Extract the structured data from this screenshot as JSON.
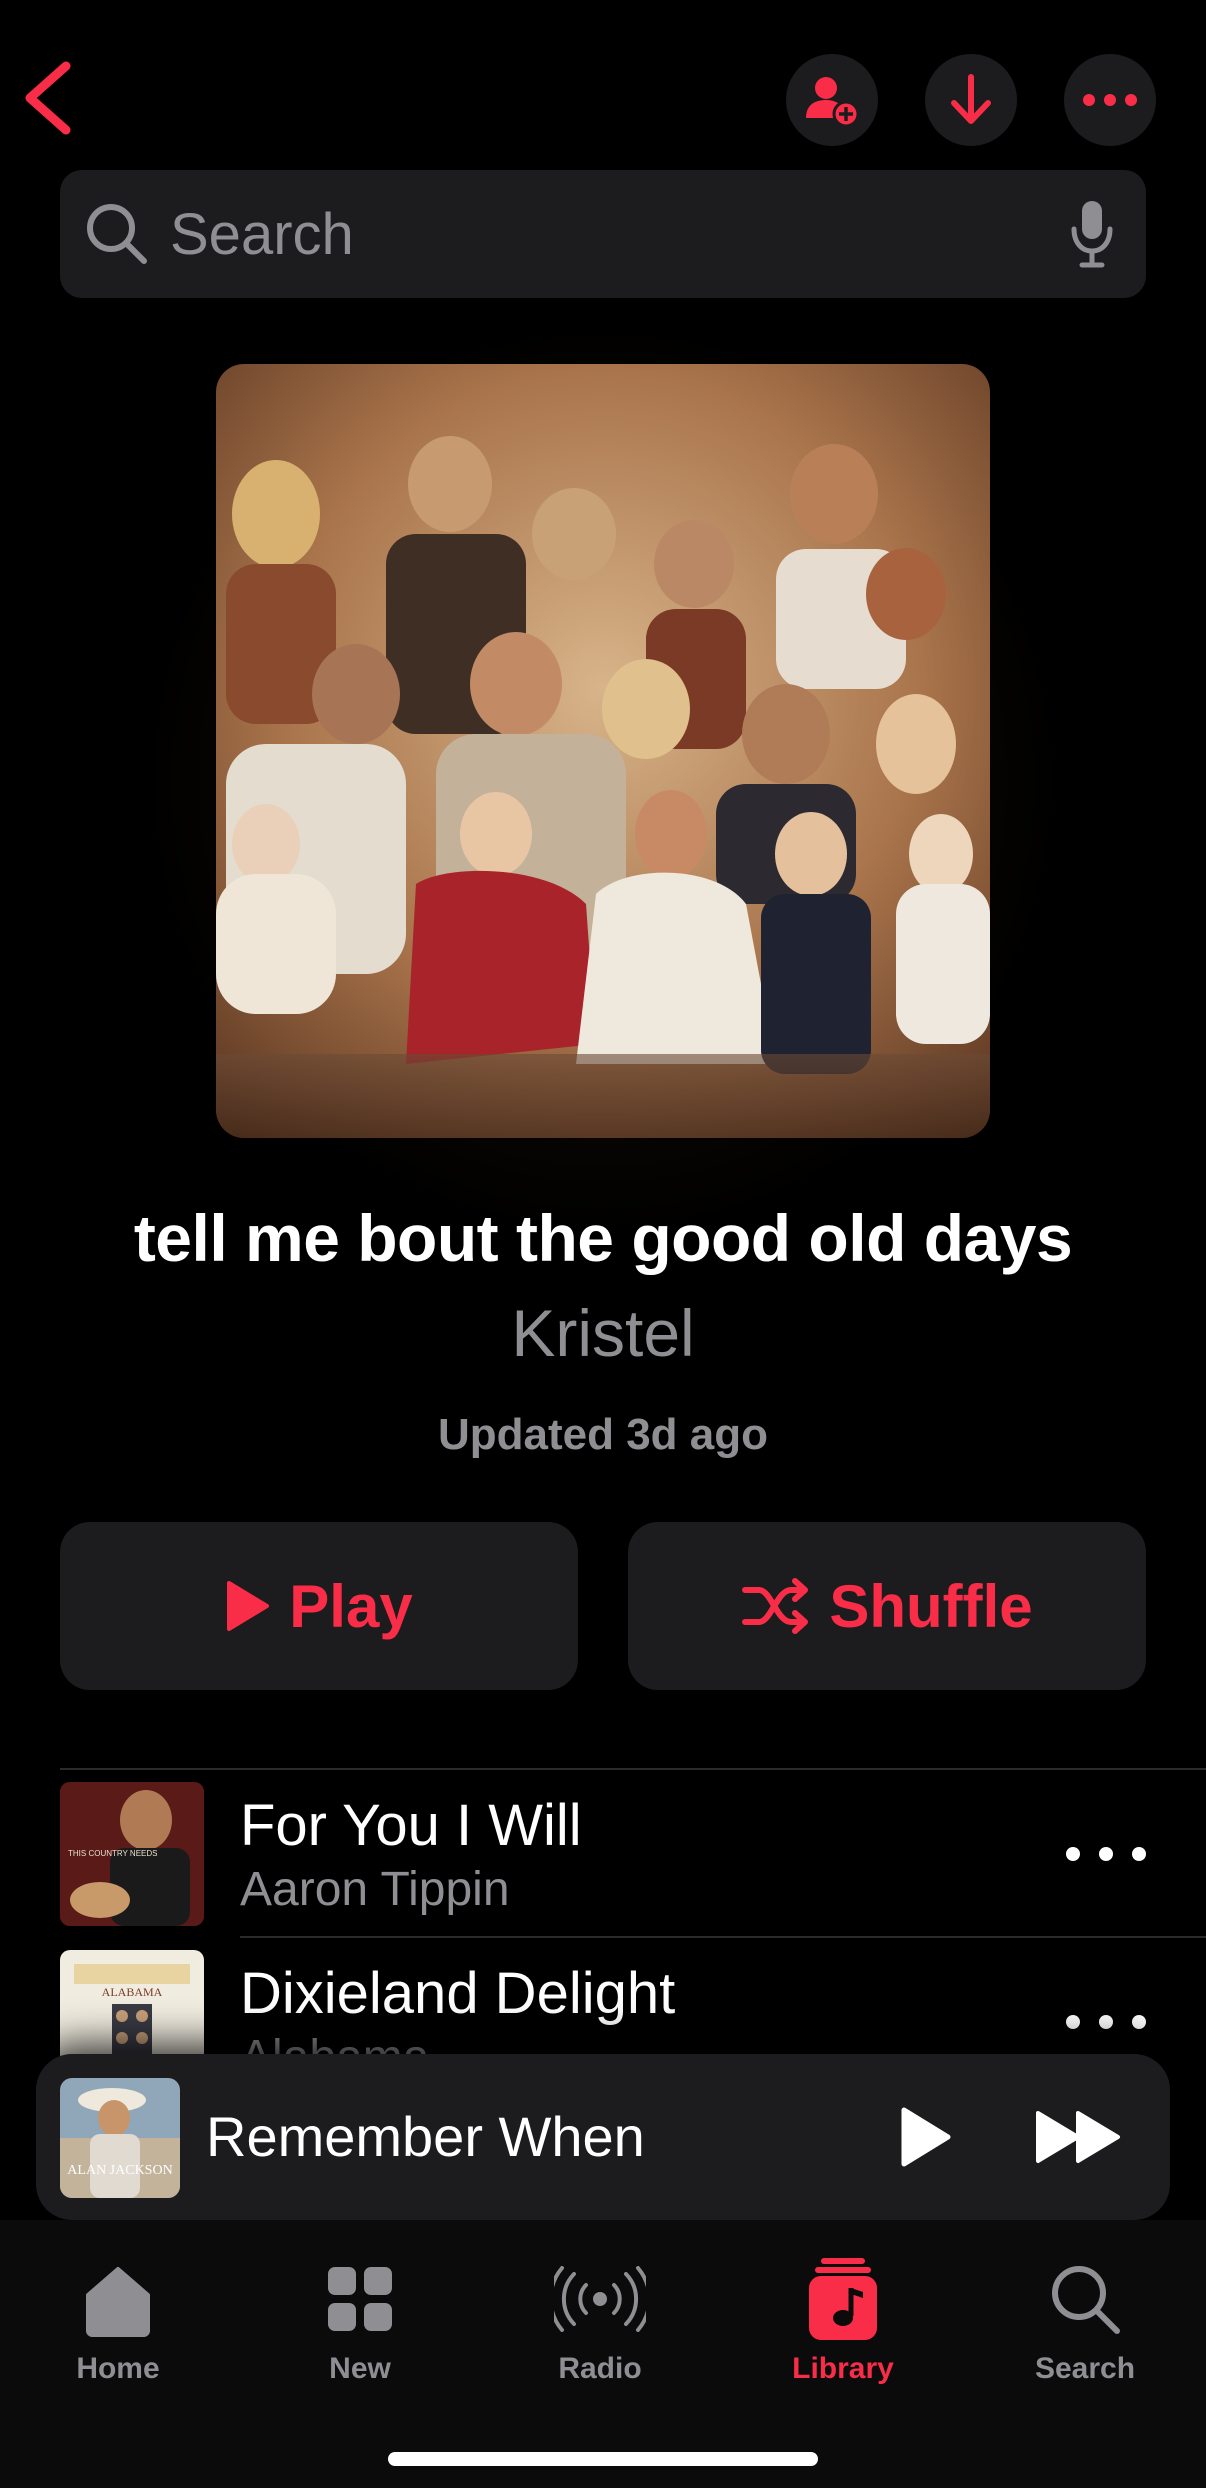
{
  "search": {
    "placeholder": "Search"
  },
  "playlist": {
    "title": "tell me bout the good old days",
    "curator": "Kristel",
    "updated": "Updated 3d ago"
  },
  "actions": {
    "play_label": "Play",
    "shuffle_label": "Shuffle"
  },
  "songs": [
    {
      "title": "For You I Will",
      "artist": "Aaron Tippin"
    },
    {
      "title": "Dixieland Delight",
      "artist": "Alabama"
    }
  ],
  "album_art_text": {
    "song0": "THIS COUNTRY NEEDS",
    "song1": "ALABAMA",
    "mini": "ALAN JACKSON"
  },
  "now_playing": {
    "title": "Remember When"
  },
  "tabs": [
    {
      "label": "Home",
      "icon": "house-icon"
    },
    {
      "label": "New",
      "icon": "grid-icon"
    },
    {
      "label": "Radio",
      "icon": "radio-icon"
    },
    {
      "label": "Library",
      "icon": "music-note-icon"
    },
    {
      "label": "Search",
      "icon": "search-icon"
    }
  ],
  "colors": {
    "accent": "#fa2d48",
    "surface": "#1c1c1e",
    "secondary_text": "#8e8e93"
  }
}
